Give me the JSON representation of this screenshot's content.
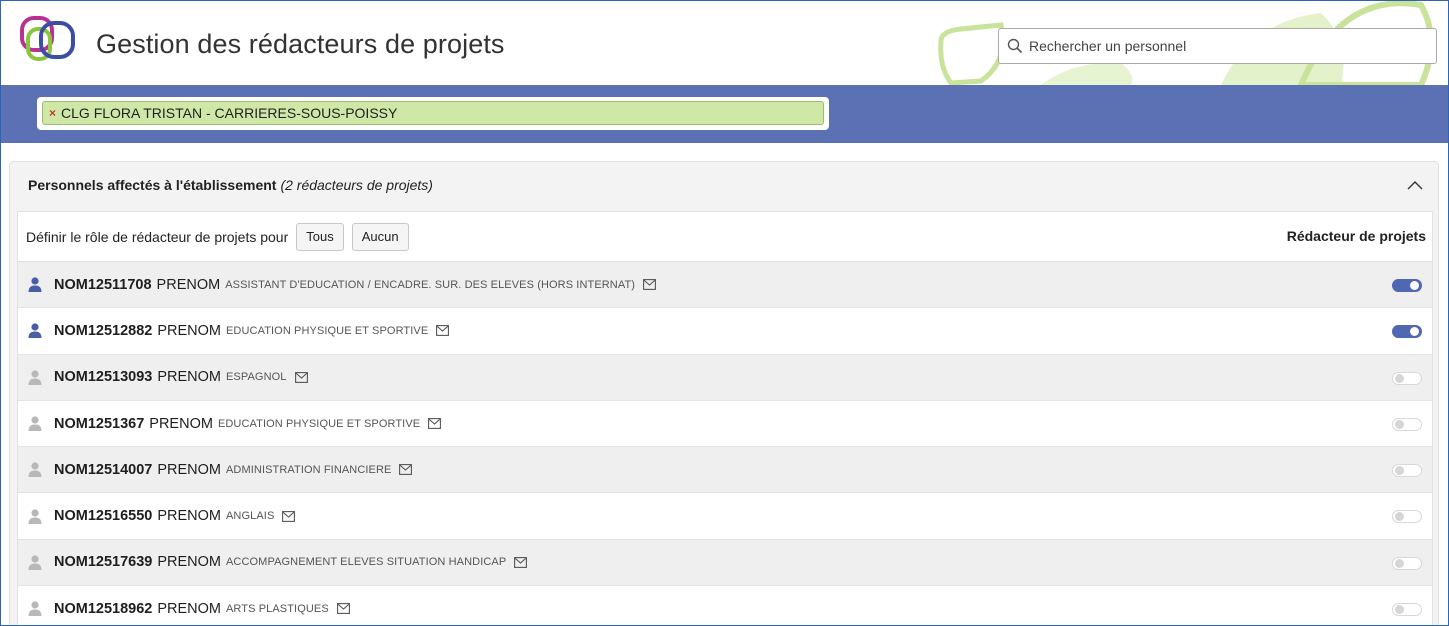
{
  "header": {
    "title": "Gestion des rédacteurs de projets",
    "search_placeholder": "Rechercher un personnel"
  },
  "filter": {
    "chip_label": "CLG FLORA TRISTAN - CARRIERES-SOUS-POISSY",
    "chip_remove": "×"
  },
  "panel": {
    "title": "Personnels affectés à l'établissement",
    "subtitle": "(2 rédacteurs de projets)",
    "toolbar_label": "Définir le rôle de rédacteur de projets pour",
    "btn_all": "Tous",
    "btn_none": "Aucun",
    "column_header": "Rédacteur de projets"
  },
  "colors": {
    "band": "#5c71b3",
    "chip": "#cfe8a8",
    "toggle_on": "#5067b1",
    "icon_active": "#4a5ea8",
    "icon_inactive": "#b8b8b8"
  },
  "staff": [
    {
      "nom": "NOM12511708",
      "prenom": "PRENOM",
      "fonction": "Assistant d'education / encadre. sur. des eleves (hors internat)",
      "redacteur": true
    },
    {
      "nom": "NOM12512882",
      "prenom": "PRENOM",
      "fonction": "Education physique et sportive",
      "redacteur": true
    },
    {
      "nom": "NOM12513093",
      "prenom": "PRENOM",
      "fonction": "Espagnol",
      "redacteur": false
    },
    {
      "nom": "NOM1251367",
      "prenom": "PRENOM",
      "fonction": "Education physique et sportive",
      "redacteur": false
    },
    {
      "nom": "NOM12514007",
      "prenom": "PRENOM",
      "fonction": "Administration financiere",
      "redacteur": false
    },
    {
      "nom": "NOM12516550",
      "prenom": "PRENOM",
      "fonction": "Anglais",
      "redacteur": false
    },
    {
      "nom": "NOM12517639",
      "prenom": "PRENOM",
      "fonction": "Accompagnement eleves situation handicap",
      "redacteur": false
    },
    {
      "nom": "NOM12518962",
      "prenom": "PRENOM",
      "fonction": "Arts plastiques",
      "redacteur": false
    }
  ]
}
